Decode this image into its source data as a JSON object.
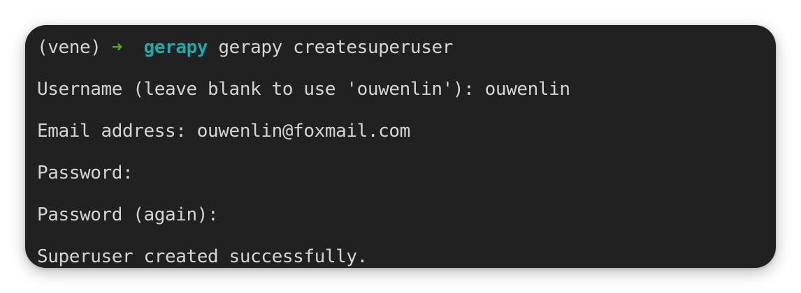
{
  "terminal": {
    "prompt": {
      "venv": "(vene)",
      "arrow": "➜",
      "cwd": "gerapy",
      "command": "gerapy createsuperuser"
    },
    "output": [
      "Username (leave blank to use 'ouwenlin'): ouwenlin",
      "Email address: ouwenlin@foxmail.com",
      "Password:",
      "Password (again):",
      "Superuser created successfully."
    ]
  },
  "colors": {
    "background": "#212121",
    "text": "#d4d4d4",
    "arrow": "#5fa334",
    "directory": "#1fa9a9"
  }
}
